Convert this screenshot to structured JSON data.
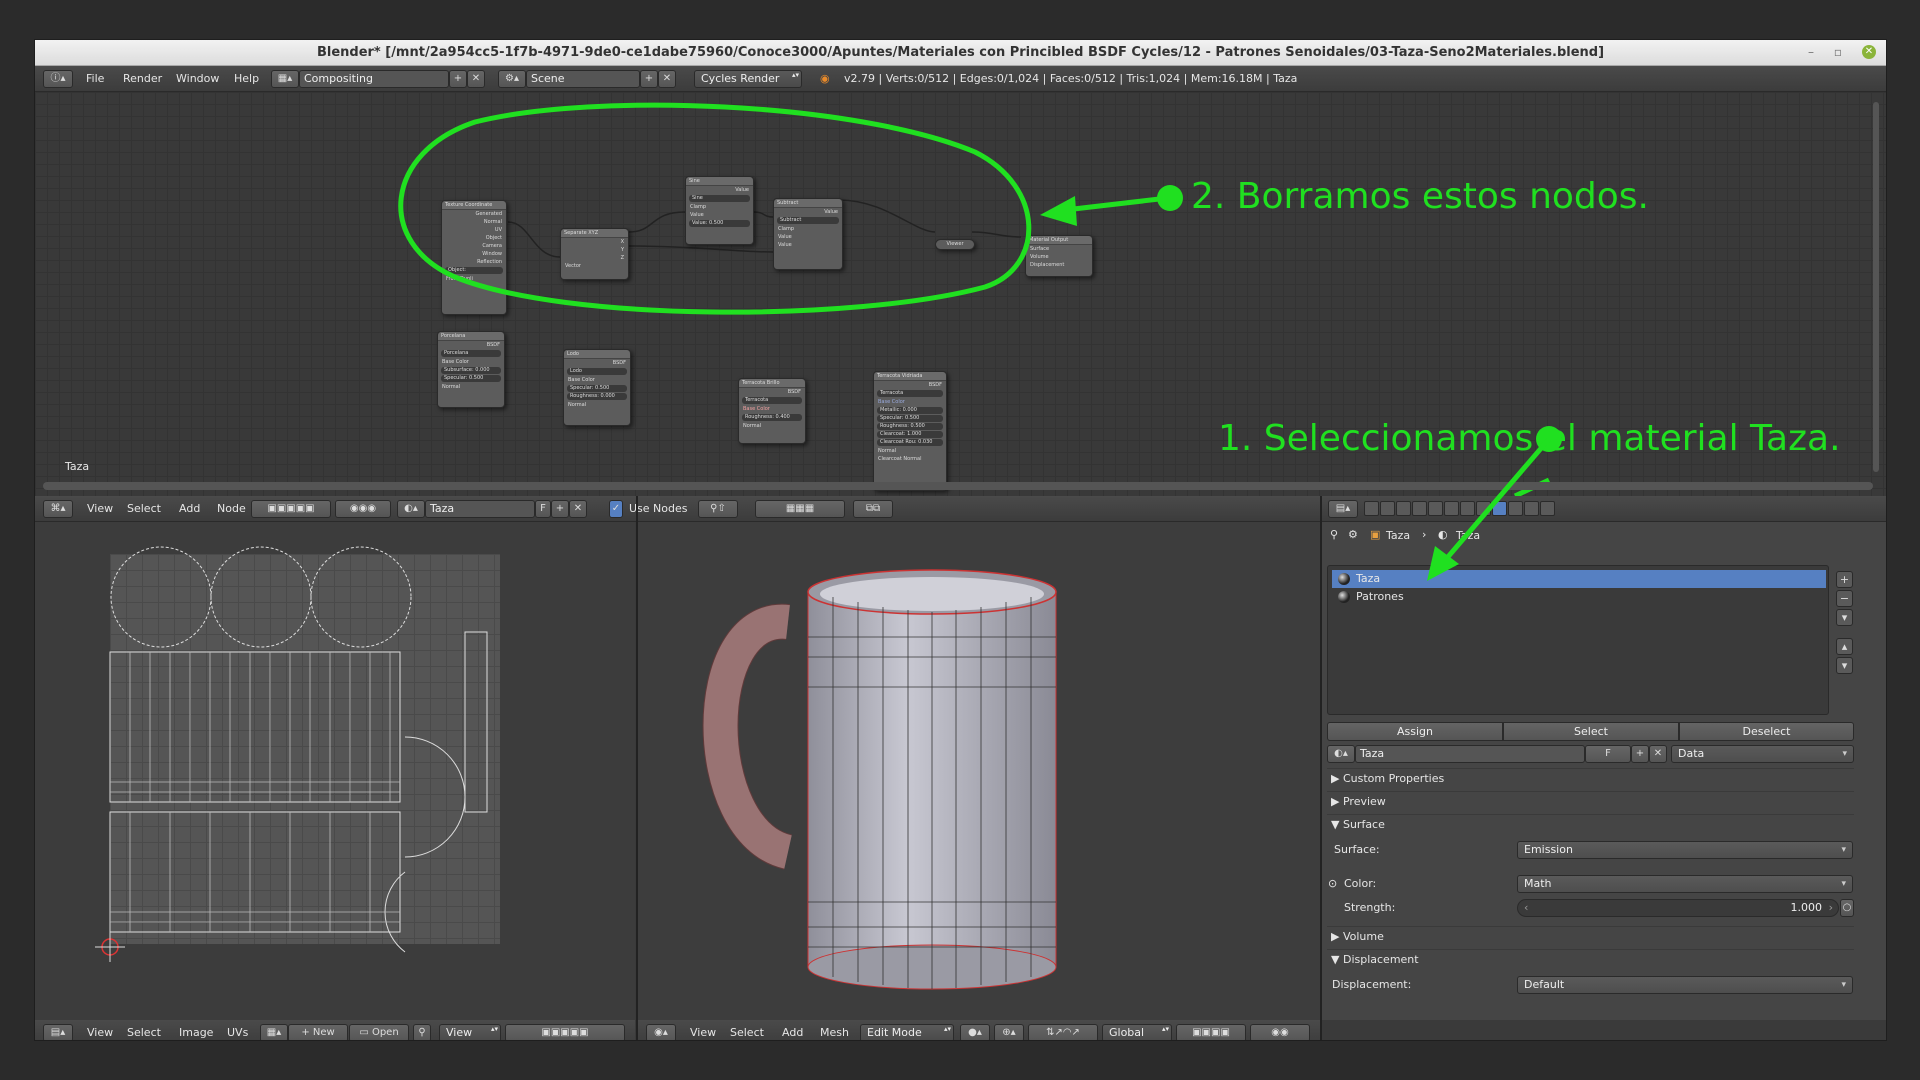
{
  "window": {
    "title": "Blender* [/mnt/2a954cc5-1f7b-4971-9de0-ce1dabe75960/Conoce3000/Apuntes/Materiales con Princibled BSDF Cycles/12 - Patrones Senoidales/03-Taza-Seno2Materiales.blend]",
    "controls": [
      "–",
      "▫",
      "✕"
    ]
  },
  "top_header": {
    "menus": [
      "File",
      "Render",
      "Window",
      "Help"
    ],
    "screen_layout": "Compositing",
    "scene": "Scene",
    "render_engine": "Cycles Render",
    "stats": "v2.79 | Verts:0/512 | Edges:0/1,024 | Faces:0/512 | Tris:1,024 | Mem:16.18M | Taza"
  },
  "node_editor": {
    "label": "Taza",
    "nodes": {
      "texcoord": {
        "title": "Texture Coordinate",
        "outputs": [
          "Generated",
          "Normal",
          "UV",
          "Object",
          "Camera",
          "Window",
          "Reflection"
        ],
        "object_field": "Object:",
        "from_dupli": "From Dupli"
      },
      "separate": {
        "title": "Separate XYZ",
        "outputs": [
          "X",
          "Y",
          "Z"
        ],
        "input": "Vector"
      },
      "sine": {
        "title": "Sine",
        "output": "Value",
        "op": "Sine",
        "clamp": "Clamp",
        "in1": "Value",
        "in2": "Value: 0.500"
      },
      "subtract": {
        "title": "Subtract",
        "output": "Value",
        "op": "Subtract",
        "clamp": "Clamp",
        "in1": "Value",
        "in2": "Value"
      },
      "viewer": {
        "title": "Viewer"
      },
      "output": {
        "title": "Material Output",
        "inputs": [
          "Surface",
          "Volume",
          "Displacement"
        ]
      },
      "porcelana": {
        "title": "Porcelana",
        "sub": "BSDF",
        "name": "Porcelana",
        "rows": [
          "Base Color",
          "Subsurface: 0.000",
          "Specular: 0.500",
          "Normal"
        ]
      },
      "lodo": {
        "title": "Lodo",
        "sub": "BSDF",
        "name": "Lodo",
        "rows": [
          "Base Color",
          "Specular: 0.500",
          "Roughness: 0.000",
          "Normal"
        ]
      },
      "terracota_brillo": {
        "title": "Terracota Brillo",
        "sub": "BSDF",
        "name": "Terracota",
        "rows": [
          "Base Color",
          "Roughness: 0.400",
          "Normal"
        ]
      },
      "terracota_vidriada": {
        "title": "Terracota Vidriada",
        "sub": "BSDF",
        "name": "Terracota",
        "rows": [
          "Base Color",
          "Metallic: 0.000",
          "Specular: 0.500",
          "Roughness: 0.500",
          "Clearcoat: 1.000",
          "Clearcoat Rou: 0.030",
          "Normal",
          "Clearcoat Normal"
        ]
      }
    }
  },
  "node_header": {
    "menus": [
      "View",
      "Select",
      "Add",
      "Node"
    ],
    "material": "Taza",
    "fake_user": "F",
    "use_nodes_label": "Use Nodes"
  },
  "uv_header": {
    "menus": [
      "View",
      "Select",
      "Image",
      "UVs"
    ],
    "new_label": "New",
    "open_label": "Open",
    "view_label": "View"
  },
  "viewport_header": {
    "menus": [
      "View",
      "Select",
      "Add",
      "Mesh"
    ],
    "mode": "Edit Mode",
    "orientation": "Global"
  },
  "properties": {
    "breadcrumb": [
      "Taza",
      "Taza"
    ],
    "materials": [
      {
        "name": "Taza",
        "selected": true
      },
      {
        "name": "Patrones",
        "selected": false
      }
    ],
    "assign": "Assign",
    "select": "Select",
    "deselect": "Deselect",
    "material_field": "Taza",
    "fake_user": "F",
    "link": "Data",
    "panels": {
      "custom": "Custom Properties",
      "preview": "Preview",
      "surface": "Surface",
      "volume": "Volume",
      "displacement": "Displacement"
    },
    "surface_label": "Surface:",
    "surface_value": "Emission",
    "color_label": "Color:",
    "color_value": "Math",
    "strength_label": "Strength:",
    "strength_value": "1.000",
    "displacement_label": "Displacement:",
    "displacement_value": "Default"
  },
  "annotations": {
    "step2": "2. Borramos estos nodos.",
    "step1": "1. Seleccionamos el material Taza."
  },
  "colors": {
    "annotation": "#20e020",
    "selection": "#5680c2"
  }
}
